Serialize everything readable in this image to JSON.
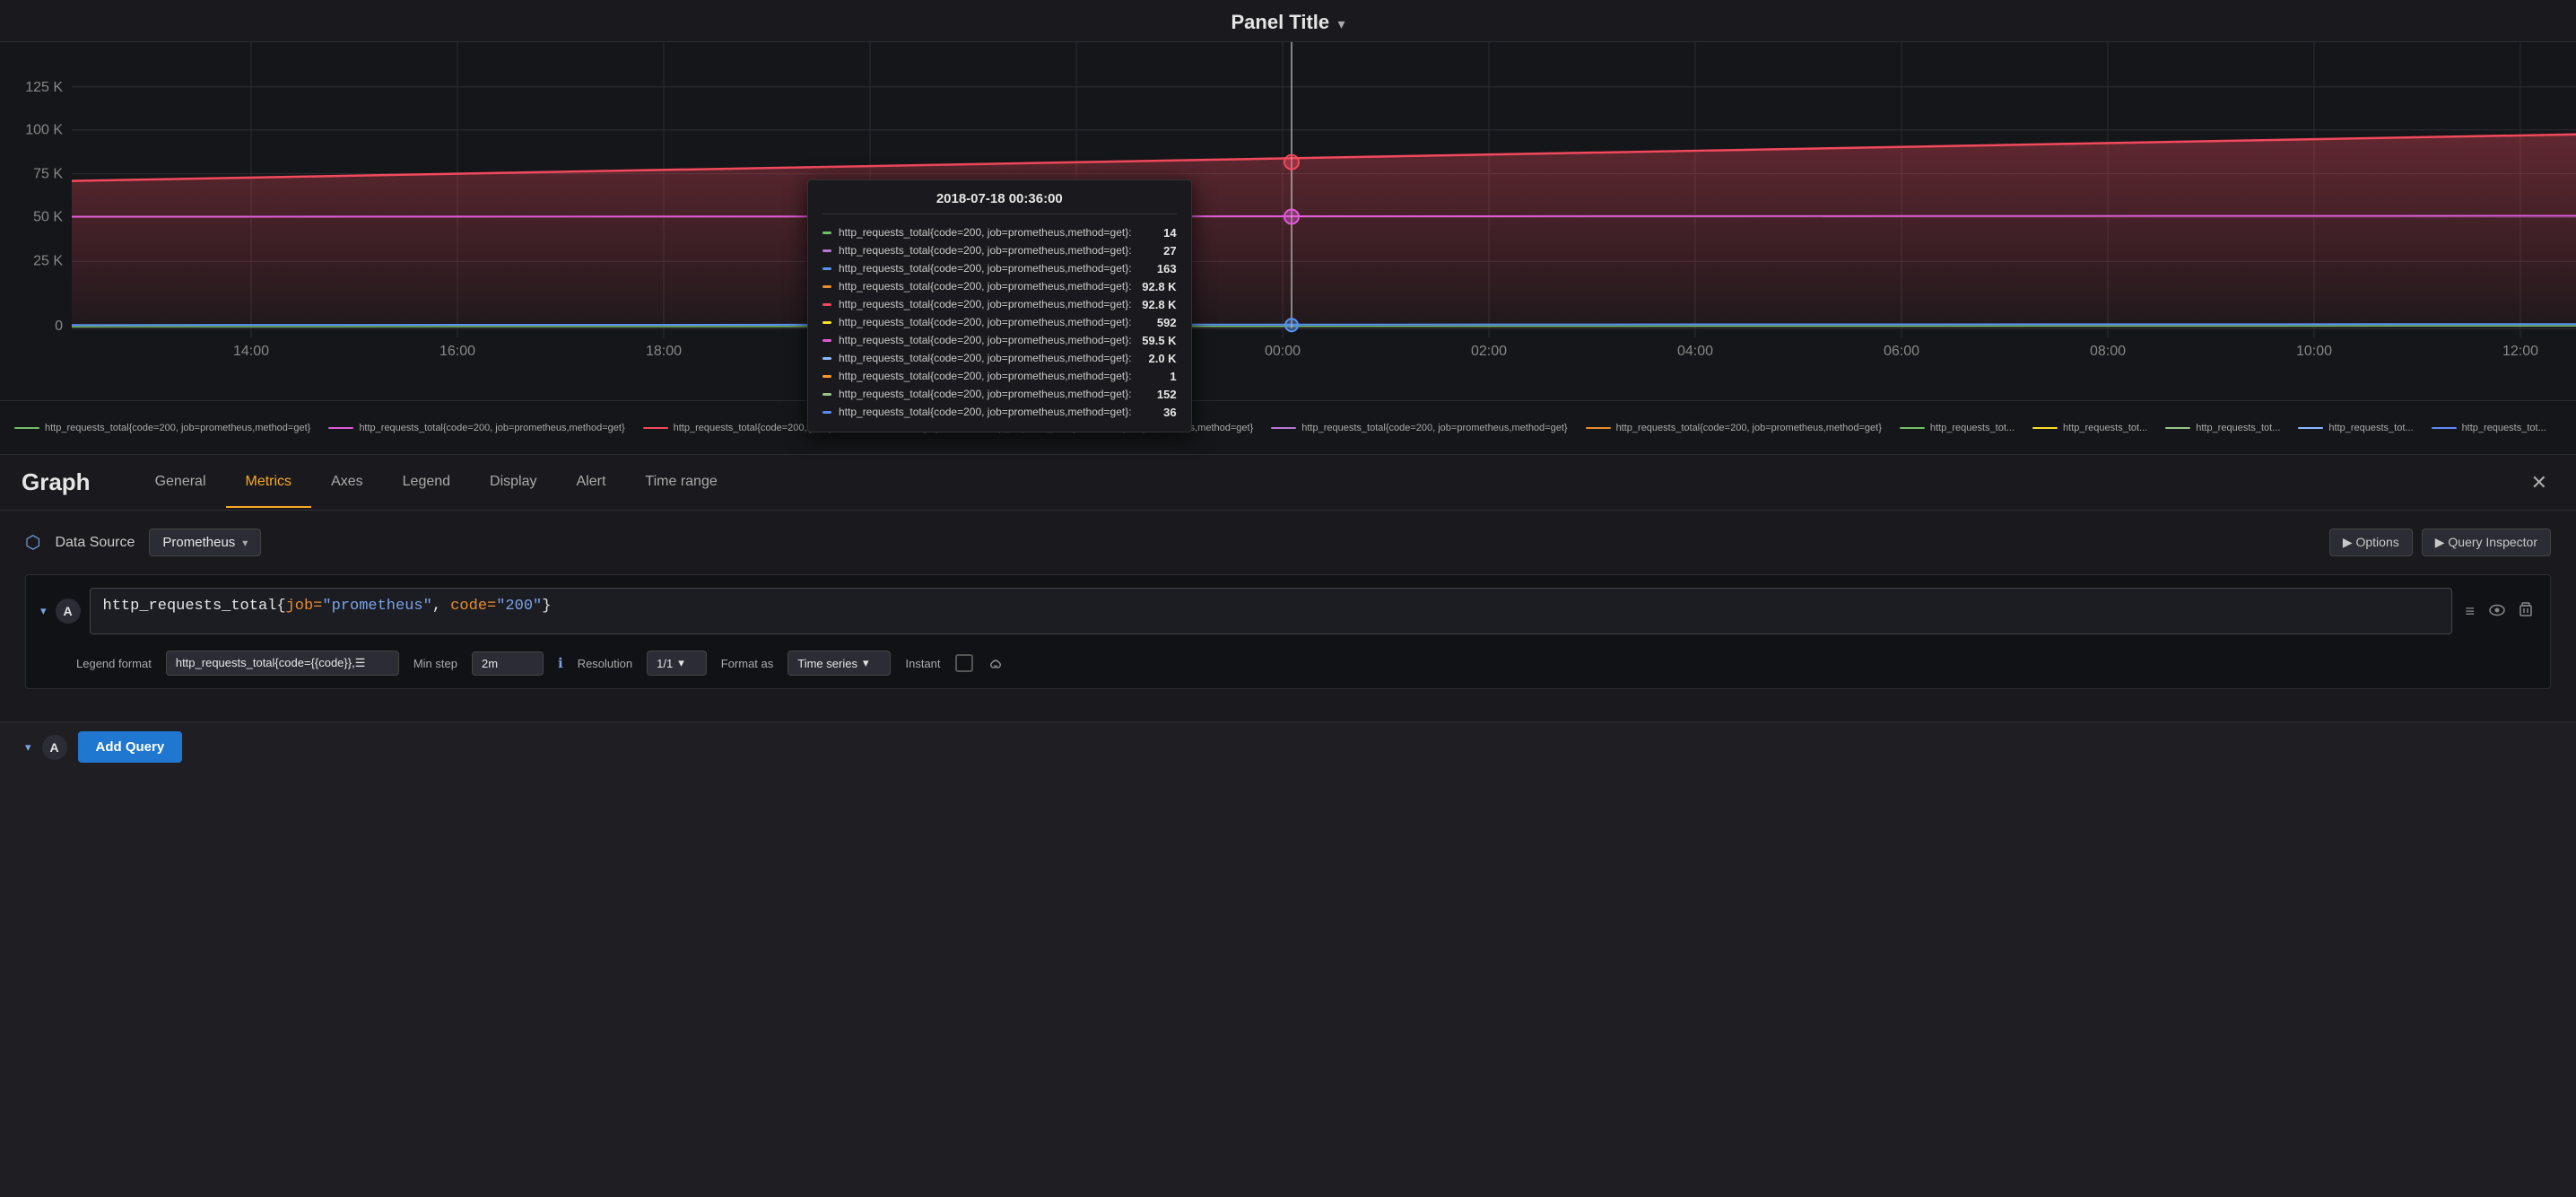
{
  "panel": {
    "title": "Panel Title",
    "title_arrow": "▾"
  },
  "graph": {
    "y_labels": [
      "125 K",
      "100 K",
      "75 K",
      "50 K",
      "25 K",
      "0"
    ],
    "x_labels": [
      "14:00",
      "16:00",
      "18:00",
      "20:00",
      "22:00",
      "00:00",
      "02:00",
      "04:00",
      "06:00",
      "08:00",
      "10:00",
      "12:00"
    ]
  },
  "tooltip": {
    "title": "2018-07-18 00:36:00",
    "rows": [
      {
        "color": "#73bf69",
        "metric": "http_requests_total{code=200, job=prometheus,method=get}:",
        "value": "14"
      },
      {
        "color": "#b877d9",
        "metric": "http_requests_total{code=200, job=prometheus,method=get}:",
        "value": "27"
      },
      {
        "color": "#5794f2",
        "metric": "http_requests_total{code=200, job=prometheus,method=get}:",
        "value": "163"
      },
      {
        "color": "#e88c2e",
        "metric": "http_requests_total{code=200, job=prometheus,method=get}:",
        "value": "92.8 K"
      },
      {
        "color": "#f2495c",
        "metric": "http_requests_total{code=200, job=prometheus,method=get}:",
        "value": "92.8 K"
      },
      {
        "color": "#fade2a",
        "metric": "http_requests_total{code=200, job=prometheus,method=get}:",
        "value": "592"
      },
      {
        "color": "#e05bd8",
        "metric": "http_requests_total{code=200, job=prometheus,method=get}:",
        "value": "59.5 K"
      },
      {
        "color": "#8ab8ff",
        "metric": "http_requests_total{code=200, job=prometheus,method=get}:",
        "value": "2.0 K"
      },
      {
        "color": "#ff9830",
        "metric": "http_requests_total{code=200, job=prometheus,method=get}:",
        "value": "1"
      },
      {
        "color": "#9ac48a",
        "metric": "http_requests_total{code=200, job=prometheus,method=get}:",
        "value": "152"
      },
      {
        "color": "#5f89f7",
        "metric": "http_requests_total{code=200, job=prometheus,method=get}:",
        "value": "36"
      }
    ]
  },
  "legend": {
    "items": [
      {
        "color": "#73bf69",
        "label": "http_requests_total{code=200, job=prometheus,method=get}"
      },
      {
        "color": "#e05bd8",
        "label": "http_requests_total{code=200, job=prometheus,method=get}"
      },
      {
        "color": "#f2495c",
        "label": "http_requests_total{code=200, job=prometheus,method=get}"
      },
      {
        "color": "#5794f2",
        "label": "http_requests_total{code=200, job=prometheus,method=get}"
      },
      {
        "color": "#b877d9",
        "label": "http_requests_total{code=200, job=prometheus,method=get}"
      },
      {
        "color": "#e88c2e",
        "label": "http_requests_total{code=200, job=prometheus,method=get}"
      },
      {
        "color": "#73bf69",
        "label": "http_requests_tot..."
      },
      {
        "color": "#fade2a",
        "label": "http_requests_tot..."
      },
      {
        "color": "#9ac48a",
        "label": "http_requests_tot..."
      },
      {
        "color": "#8ab8ff",
        "label": "http_requests_tot..."
      },
      {
        "color": "#5f89f7",
        "label": "http_requests_tot..."
      }
    ]
  },
  "tabs": {
    "section_label": "Graph",
    "items": [
      {
        "label": "General",
        "active": false
      },
      {
        "label": "Metrics",
        "active": true
      },
      {
        "label": "Axes",
        "active": false
      },
      {
        "label": "Legend",
        "active": false
      },
      {
        "label": "Display",
        "active": false
      },
      {
        "label": "Alert",
        "active": false
      },
      {
        "label": "Time range",
        "active": false
      }
    ]
  },
  "datasource": {
    "label": "Data Source",
    "value": "Prometheus",
    "arrow": "▾"
  },
  "actions": {
    "options_label": "▶ Options",
    "query_inspector_label": "▶ Query Inspector"
  },
  "query": {
    "collapse_icon": "▾",
    "letter": "A",
    "expression_normal": "http_requests_total{",
    "expression_key1": "job=",
    "expression_val1": "\"prometheus\"",
    "expression_comma": ", ",
    "expression_key2": "code=",
    "expression_val2": "\"200\"",
    "expression_close": "}",
    "icons": {
      "lines": "≡",
      "eye": "👁",
      "trash": "🗑"
    }
  },
  "query_options": {
    "legend_format_label": "Legend format",
    "legend_format_value": "http_requests_total{code={{code}},☰",
    "min_step_label": "Min step",
    "min_step_value": "2m",
    "resolution_label": "Resolution",
    "resolution_value": "1/1",
    "format_as_label": "Format as",
    "format_as_value": "Time series",
    "format_as_arrow": "▾",
    "instant_label": "Instant"
  },
  "add_query": {
    "collapse_icon": "▾",
    "letter": "A",
    "button_label": "Add Query"
  }
}
